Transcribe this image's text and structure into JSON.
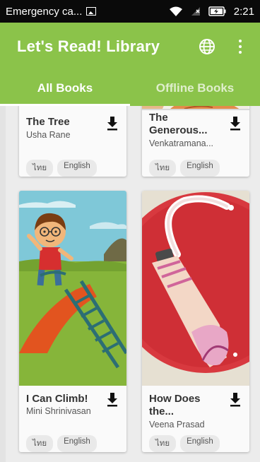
{
  "status_bar": {
    "notification_text": "Emergency ca...",
    "time": "2:21"
  },
  "app_bar": {
    "title": "Let's Read! Library",
    "tabs": [
      {
        "label": "All Books",
        "active": true
      },
      {
        "label": "Offline Books",
        "active": false
      }
    ]
  },
  "books": [
    {
      "title": "The Tree",
      "author": "Usha Rane",
      "languages": [
        "ไทย",
        "English"
      ]
    },
    {
      "title": "The Generous...",
      "author": "Venkatramana...",
      "languages": [
        "ไทย",
        "English"
      ]
    },
    {
      "title": "I Can Climb!",
      "author": "Mini Shrinivasan",
      "languages": [
        "ไทย",
        "English"
      ]
    },
    {
      "title": "How Does the...",
      "author": "Veena Prasad",
      "languages": [
        "ไทย",
        "English"
      ]
    }
  ],
  "colors": {
    "primary": "#8bc34a",
    "status_bar": "#0a0a0a",
    "background": "#ececec"
  }
}
